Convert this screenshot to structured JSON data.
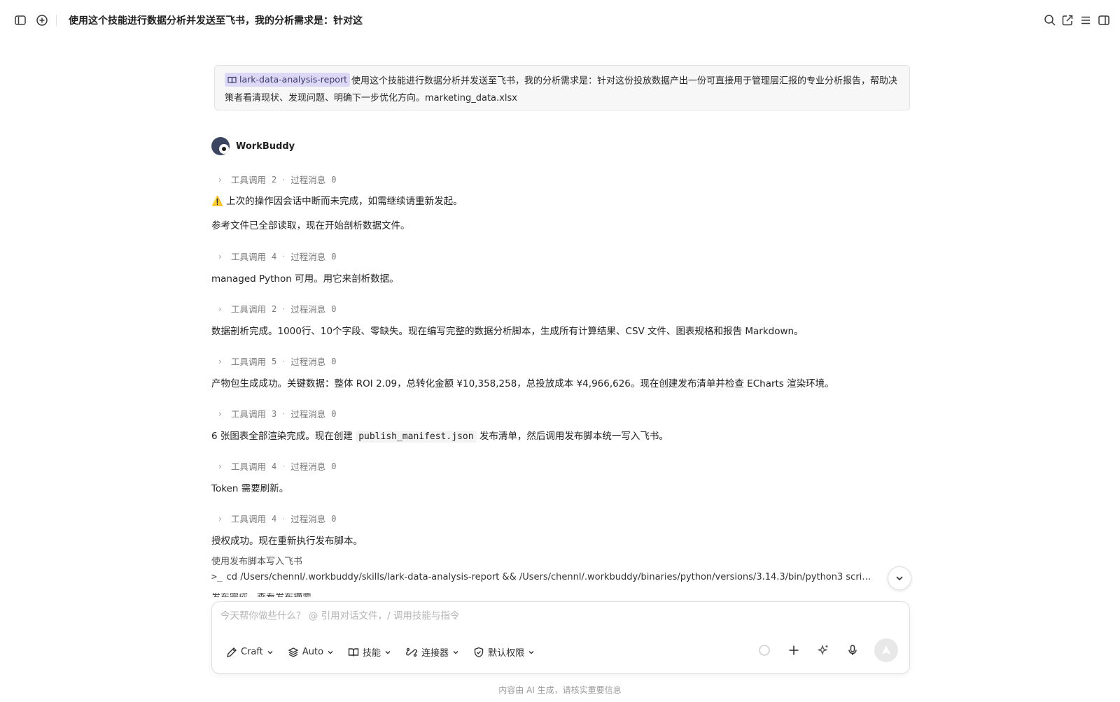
{
  "header": {
    "title": "使用这个技能进行数据分析并发送至飞书，我的分析需求是：针对这"
  },
  "user_message": {
    "skill_chip": "lark-data-analysis-report",
    "text": "使用这个技能进行数据分析并发送至飞书，我的分析需求是：针对这份投放数据产出一份可直接用于管理层汇报的专业分析报告，帮助决策者看清现状、发现问题、明确下一步优化方向。marketing_data.xlsx"
  },
  "assistant": {
    "name": "WorkBuddy"
  },
  "labels": {
    "tool_call": "工具调用",
    "process_msg": "过程消息",
    "sep": "·"
  },
  "tool_rows": [
    {
      "tool_count": "2",
      "msg_count": "0"
    },
    {
      "tool_count": "4",
      "msg_count": "0"
    },
    {
      "tool_count": "2",
      "msg_count": "0"
    },
    {
      "tool_count": "5",
      "msg_count": "0"
    },
    {
      "tool_count": "3",
      "msg_count": "0"
    },
    {
      "tool_count": "4",
      "msg_count": "0"
    },
    {
      "tool_count": "4",
      "msg_count": "0"
    }
  ],
  "messages": {
    "m0_icon": "⚠️",
    "m0": "上次的操作因会话中断而未完成，如需继续请重新发起。",
    "m1": "参考文件已全部读取，现在开始剖析数据文件。",
    "m2": "managed Python 可用。用它来剖析数据。",
    "m3": "数据剖析完成。1000行、10个字段、零缺失。现在编写完整的数据分析脚本，生成所有计算结果、CSV 文件、图表规格和报告 Markdown。",
    "m4": "产物包生成成功。关键数据：整体 ROI 2.09，总转化金额 ¥10,358,258，总投放成本 ¥4,966,626。现在创建发布清单并检查 ECharts 渲染环境。",
    "m5_pre": "6 张图表全部渲染完成。现在创建",
    "m5_code": "publish_manifest.json",
    "m5_post": "发布清单，然后调用发布脚本统一写入飞书。",
    "m6": "Token 需要刷新。",
    "m7": "授权成功。现在重新执行发布脚本。"
  },
  "command": {
    "label": "使用发布脚本写入飞书",
    "prompt": ">_",
    "text": "cd /Users/chennl/.workbuddy/skills/lark-data-analysis-report && /Users/chennl/.workbuddy/binaries/python/versions/3.14.3/bin/python3 scripts/...",
    "cutoff_text": "发布完成，查看发布摘要"
  },
  "composer": {
    "placeholder": "今天帮你做些什么？ @ 引用对话文件，/ 调用技能与指令",
    "craft": "Craft",
    "auto": "Auto",
    "skills": "技能",
    "connectors": "连接器",
    "permissions": "默认权限"
  },
  "footer": {
    "disclaimer": "内容由 AI 生成，请核实重要信息"
  }
}
